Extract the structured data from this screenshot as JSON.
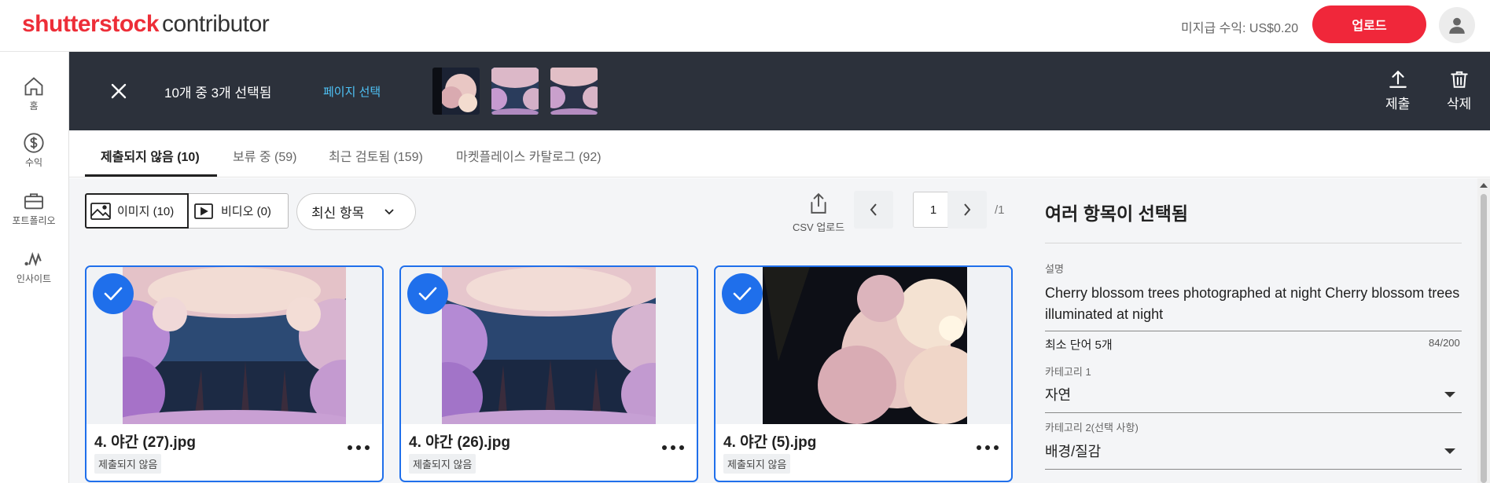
{
  "header": {
    "logo_brand": "shutterstock",
    "logo_product": "contributor",
    "earnings": "미지급 수익: US$0.20",
    "upload_label": "업로드"
  },
  "sidebar": {
    "items": [
      {
        "label": "홈",
        "icon": "home-icon"
      },
      {
        "label": "수익",
        "icon": "dollar-icon"
      },
      {
        "label": "포트폴리오",
        "icon": "briefcase-icon"
      },
      {
        "label": "인사이트",
        "icon": "insights-icon"
      }
    ]
  },
  "selection_bar": {
    "count_text": "10개 중 3개 선택됨",
    "page_select": "페이지 선택",
    "submit_label": "제출",
    "delete_label": "삭제"
  },
  "tabs": [
    {
      "label": "제출되지 않음 (10)",
      "active": true
    },
    {
      "label": "보류 중 (59)",
      "active": false
    },
    {
      "label": "최근 검토됨 (159)",
      "active": false
    },
    {
      "label": "마켓플레이스 카탈로그 (92)",
      "active": false
    }
  ],
  "toolbar": {
    "images_label": "이미지 (10)",
    "videos_label": "비디오 (0)",
    "sort_label": "최신 항목",
    "csv_label": "CSV 업로드",
    "page_current": "1",
    "page_total": "/1"
  },
  "cards": [
    {
      "filename": "4. 야간 (27).jpg",
      "status": "제출되지 않음",
      "selected": true
    },
    {
      "filename": "4. 야간 (26).jpg",
      "status": "제출되지 않음",
      "selected": true
    },
    {
      "filename": "4. 야간 (5).jpg",
      "status": "제출되지 않음",
      "selected": true
    }
  ],
  "panel": {
    "title": "여러 항목이 선택됨",
    "description_label": "설명",
    "description": "Cherry blossom trees photographed at night Cherry blossom trees illuminated at night",
    "min_words_hint": "최소 단어 5개",
    "char_count": "84/200",
    "category1_label": "카테고리 1",
    "category1_value": "자연",
    "category2_label": "카테고리 2(선택 사항)",
    "category2_value": "배경/질감"
  },
  "colors": {
    "brand_red": "#f0273a",
    "selection_bar": "#2c313b",
    "accent_blue": "#1f6feb",
    "link_cyan": "#4fc3f7"
  }
}
